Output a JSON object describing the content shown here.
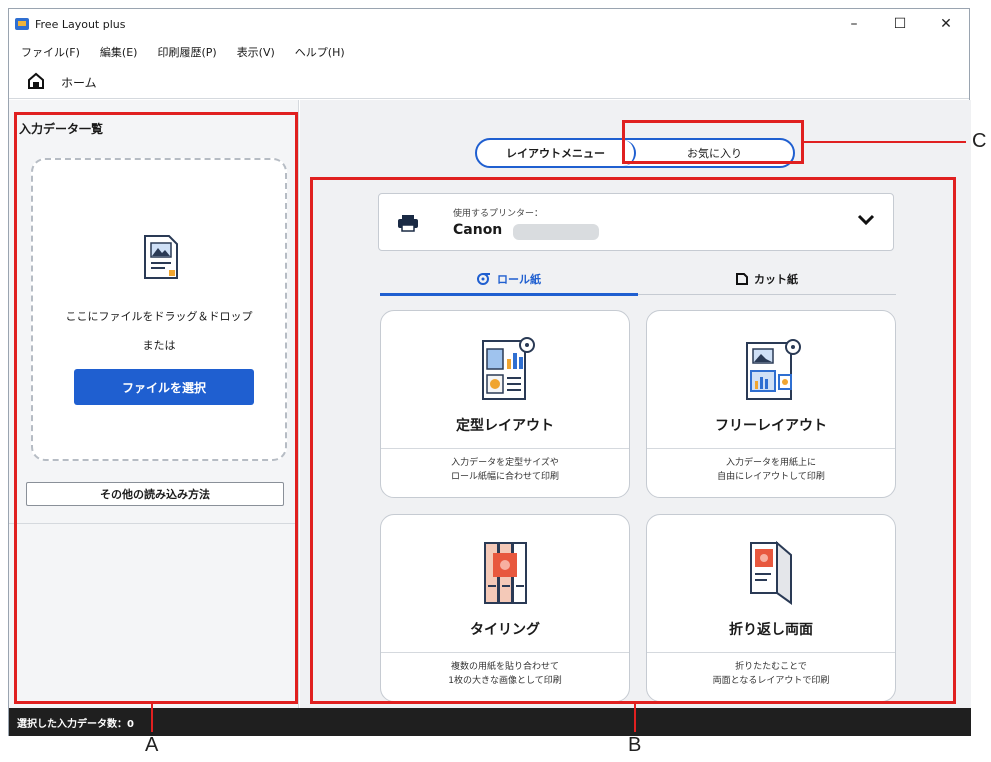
{
  "window": {
    "title": "Free Layout plus",
    "controls": {
      "minimize": "–",
      "maximize": "☐",
      "close": "✕"
    }
  },
  "menu": [
    "ファイル(F)",
    "編集(E)",
    "印刷履歴(P)",
    "表示(V)",
    "ヘルプ(H)"
  ],
  "home": {
    "label": "ホーム"
  },
  "left_panel": {
    "title": "入力データ一覧",
    "drop_text": "ここにファイルをドラッグ＆ドロップ",
    "or_text": "または",
    "select_button": "ファイルを選択",
    "other_button": "その他の読み込み方法"
  },
  "segmented": {
    "layout_menu": "レイアウトメニュー",
    "favorites": "お気に入り"
  },
  "printer": {
    "label": "使用するプリンター：",
    "name": "Canon"
  },
  "paper_tabs": {
    "roll": "ロール紙",
    "cut": "カット紙"
  },
  "cards": [
    {
      "title": "定型レイアウト",
      "desc1": "入力データを定型サイズや",
      "desc2": "ロール紙幅に合わせて印刷"
    },
    {
      "title": "フリーレイアウト",
      "desc1": "入力データを用紙上に",
      "desc2": "自由にレイアウトして印刷"
    },
    {
      "title": "タイリング",
      "desc1": "複数の用紙を貼り合わせて",
      "desc2": "1枚の大きな画像として印刷"
    },
    {
      "title": "折り返し両面",
      "desc1": "折りたたむことで",
      "desc2": "両面となるレイアウトで印刷"
    }
  ],
  "status": {
    "selected_count": "選択した入力データ数：0"
  },
  "callouts": {
    "a": "A",
    "b": "B",
    "c": "C"
  },
  "colors": {
    "accent": "#1f5fd0",
    "highlight": "#e02020",
    "statusbar": "#1f1f1f"
  },
  "icons": {
    "home": "home-icon",
    "document": "document-icon",
    "printer": "printer-icon",
    "chevron": "chevron-down-icon",
    "roll": "roll-paper-icon",
    "cut": "cut-paper-icon"
  }
}
